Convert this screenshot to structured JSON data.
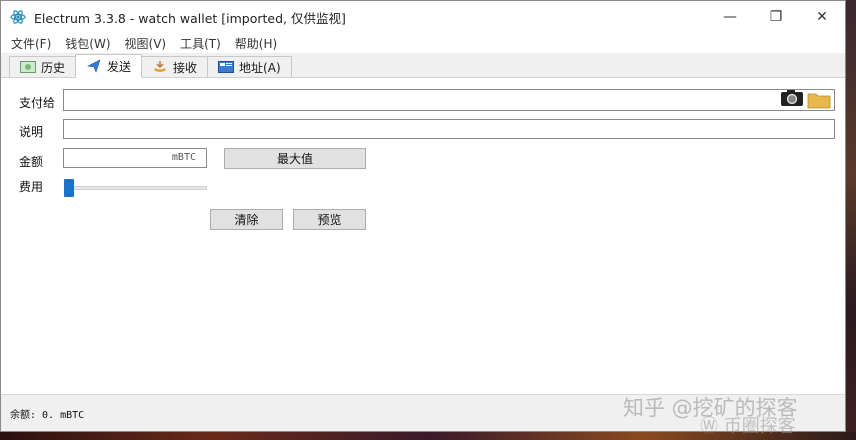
{
  "window": {
    "title": "Electrum 3.3.8  -  watch wallet  [imported, 仅供监视]",
    "minimize_glyph": "—",
    "maximize_glyph": "❐",
    "close_glyph": "✕"
  },
  "menu": [
    {
      "label": "文件(F)"
    },
    {
      "label": "钱包(W)"
    },
    {
      "label": "视图(V)"
    },
    {
      "label": "工具(T)"
    },
    {
      "label": "帮助(H)"
    }
  ],
  "tabs": [
    {
      "label": "历史",
      "icon": "history-icon"
    },
    {
      "label": "发送",
      "icon": "send-icon",
      "active": true
    },
    {
      "label": "接收",
      "icon": "receive-icon"
    },
    {
      "label": "地址(A)",
      "icon": "addresses-icon"
    }
  ],
  "send": {
    "pay_to_label": "支付给",
    "pay_to_value": "",
    "description_label": "说明",
    "description_value": "",
    "amount_label": "金额",
    "amount_value": "",
    "amount_unit": "mBTC",
    "max_button": "最大值",
    "fee_label": "费用",
    "fee_level": 0,
    "clear_button": "清除",
    "preview_button": "预览"
  },
  "status": {
    "balance": "余额: 0. mBTC"
  },
  "watermark": {
    "line1": "知乎 @挖矿的探客",
    "line2": "Ⓦ 币圈探客"
  },
  "colors": {
    "accent": "#1a73c8",
    "folder": "#e9b84c"
  }
}
